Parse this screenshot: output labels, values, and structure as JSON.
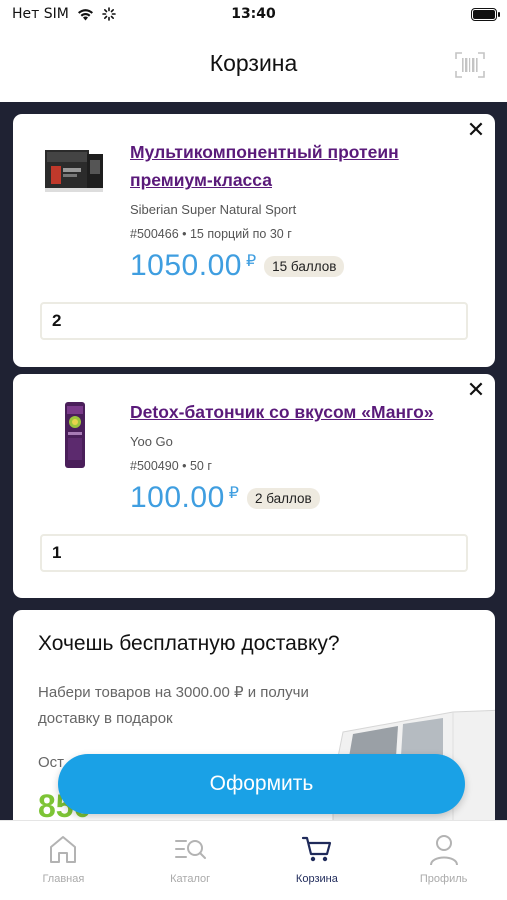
{
  "status_bar": {
    "carrier": "Нет SIM",
    "time": "13:40"
  },
  "header": {
    "title": "Корзина",
    "scan_icon": "barcode-scan-icon"
  },
  "cart": {
    "items": [
      {
        "title": "Мультикомпонентный протеин премиум-класса",
        "brand": "Siberian Super Natural Sport",
        "sku": "#500466 • 15 порций по 30 г",
        "price": "1050.00",
        "currency": "₽",
        "points": "15 баллов",
        "quantity": "2",
        "image": "protein-box-image"
      },
      {
        "title": "Detox-батончик со вкусом «Манго»",
        "brand": "Yoo Go",
        "sku": "#500490 • 50 г",
        "price": "100.00",
        "currency": "₽",
        "points": "2 баллов",
        "quantity": "1",
        "image": "detox-bar-image"
      }
    ]
  },
  "promo": {
    "title": "Хочешь бесплатную доставку?",
    "text": "Набери товаров на 3000.00 ₽ и получи доставку в подарок",
    "rest_label": "Ост",
    "amount": "850"
  },
  "checkout": {
    "label": "Оформить"
  },
  "tabbar": {
    "tabs": [
      {
        "label": "Главная",
        "icon": "home-icon",
        "active": false
      },
      {
        "label": "Каталог",
        "icon": "catalog-search-icon",
        "active": false
      },
      {
        "label": "Корзина",
        "icon": "cart-icon",
        "active": true
      },
      {
        "label": "Профиль",
        "icon": "profile-icon",
        "active": false
      }
    ]
  },
  "colors": {
    "accent": "#1aa1e6",
    "price": "#3f9ee0",
    "link": "#5a1a7a",
    "background": "#1f2233",
    "promo_amount": "#7dc436"
  }
}
